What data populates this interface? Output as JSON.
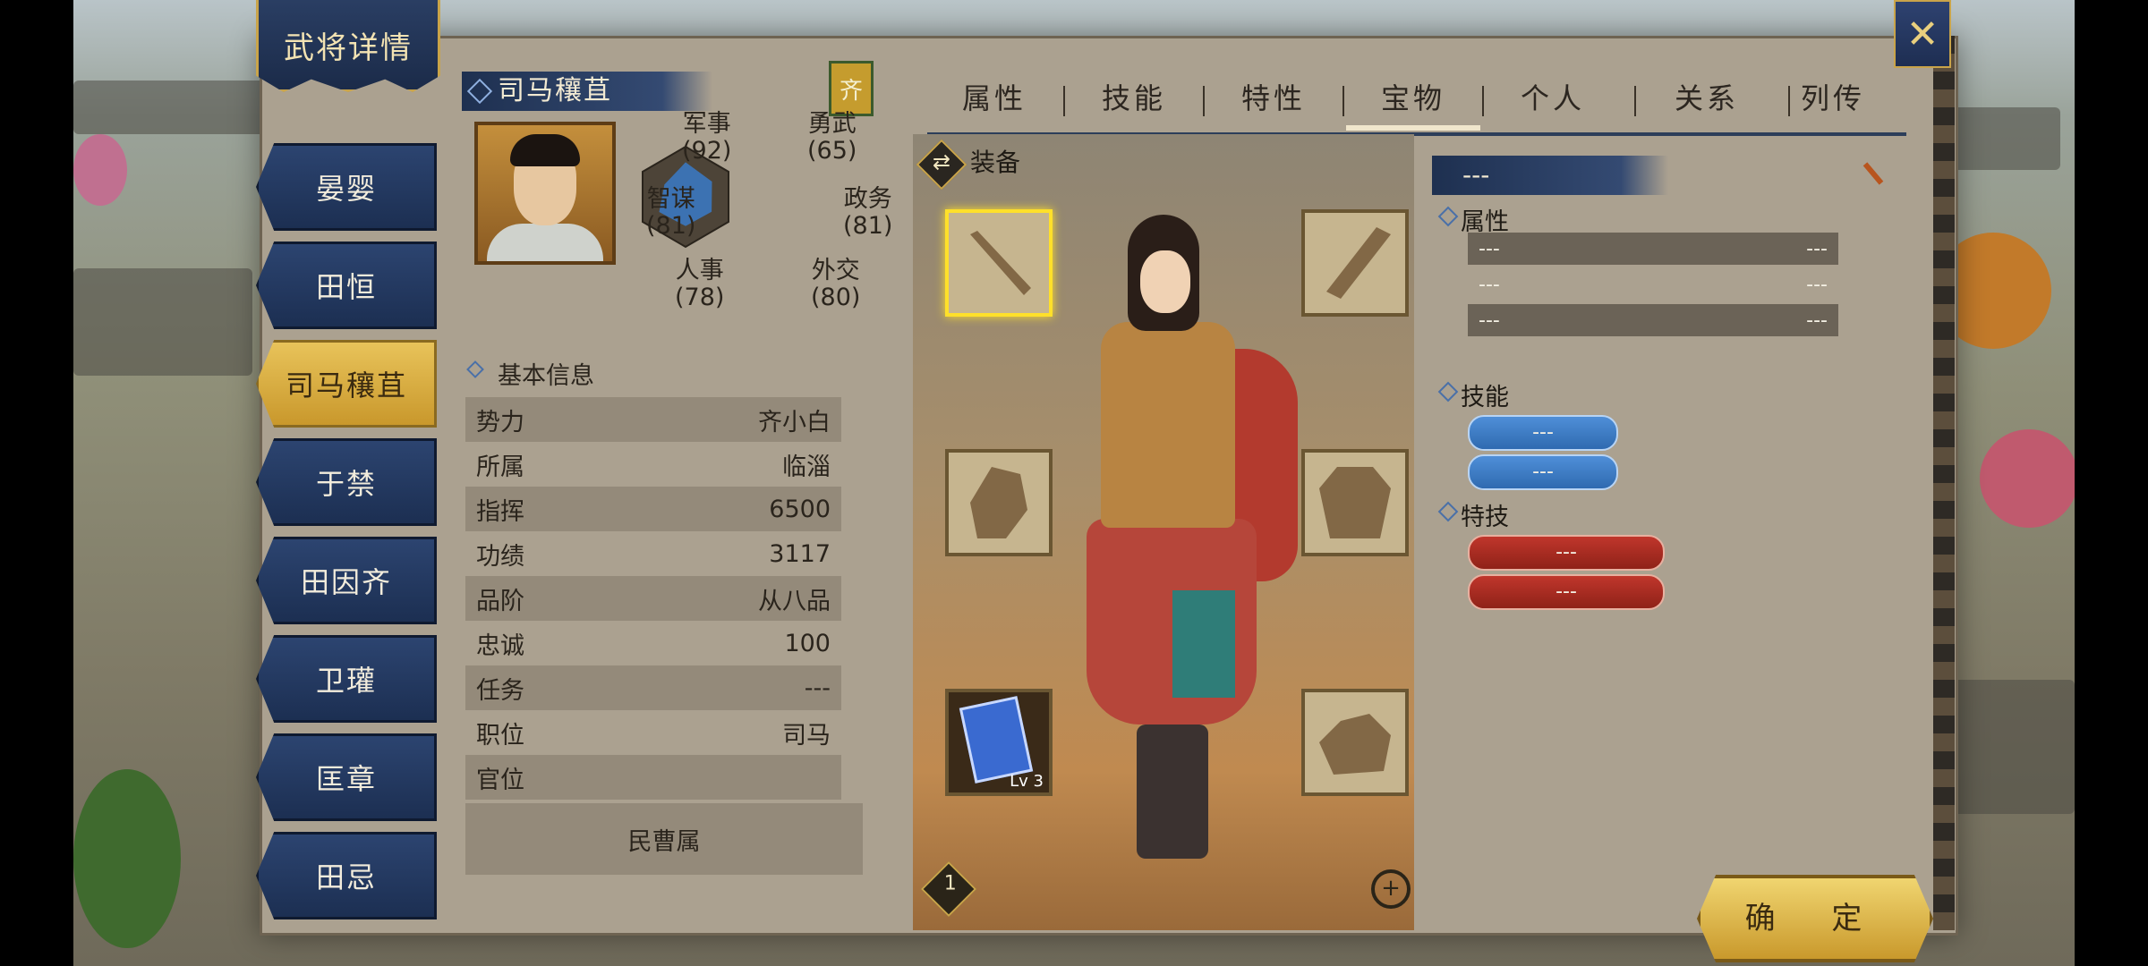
{
  "title": "武将详情",
  "close_icon": "close-x-icon",
  "officers": [
    "晏婴",
    "田恒",
    "司马穰苴",
    "于禁",
    "田因齐",
    "卫瓘",
    "匡章",
    "田忌"
  ],
  "active_officer_index": 2,
  "officer": {
    "name": "司马穰苴",
    "state": "齐",
    "stats": {
      "military_label": "军事",
      "military_value": "(92)",
      "valor_label": "勇武",
      "valor_value": "(65)",
      "strategy_label": "智谋",
      "strategy_value": "(81)",
      "politics_label": "政务",
      "politics_value": "(81)",
      "personnel_label": "人事",
      "personnel_value": "(78)",
      "diplomacy_label": "外交",
      "diplomacy_value": "(80)"
    },
    "radar_values": [
      92,
      81,
      80,
      78,
      81,
      65
    ]
  },
  "basic_info": {
    "title": "基本信息",
    "rows": [
      {
        "label": "势力",
        "value": "齐小白"
      },
      {
        "label": "所属",
        "value": "临淄"
      },
      {
        "label": "指挥",
        "value": "6500"
      },
      {
        "label": "功绩",
        "value": "3117"
      },
      {
        "label": "品阶",
        "value": "从八品"
      },
      {
        "label": "忠诚",
        "value": "100"
      },
      {
        "label": "任务",
        "value": "---"
      },
      {
        "label": "职位",
        "value": "司马"
      },
      {
        "label": "官位",
        "value": ""
      }
    ],
    "office": "民曹属"
  },
  "tabs": [
    "属性",
    "技能",
    "特性",
    "宝物",
    "个人",
    "关系",
    "列传"
  ],
  "active_tab_index": 3,
  "equipment": {
    "header": "装备",
    "slots": [
      {
        "name": "weapon-slot",
        "icon": "halberd-icon"
      },
      {
        "name": "bow-slot",
        "icon": "bow-icon"
      },
      {
        "name": "horse-slot",
        "icon": "horse-icon"
      },
      {
        "name": "armor-slot",
        "icon": "armor-icon"
      },
      {
        "name": "book-slot",
        "icon": "book-icon",
        "level": "Lv 3"
      },
      {
        "name": "treasure-slot",
        "icon": "treasure-icon"
      }
    ],
    "page": "1",
    "zoom_icon": "zoom-in-icon"
  },
  "treasure_detail": {
    "name": "---",
    "attributes_title": "属性",
    "attributes": [
      {
        "left": "---",
        "right": "---"
      },
      {
        "left": "---",
        "right": "---"
      },
      {
        "left": "---",
        "right": "---"
      }
    ],
    "skills_title": "技能",
    "skills": [
      "---",
      "---"
    ],
    "specials_title": "特技",
    "specials": [
      "---",
      "---"
    ]
  },
  "confirm_label": "确 定",
  "colors": {
    "navy": "#1e3050",
    "gold": "#c9a44a",
    "active_tab_gold": "#e8c35a",
    "skill_blue": "#2f6ab0",
    "special_red": "#8f2218"
  }
}
